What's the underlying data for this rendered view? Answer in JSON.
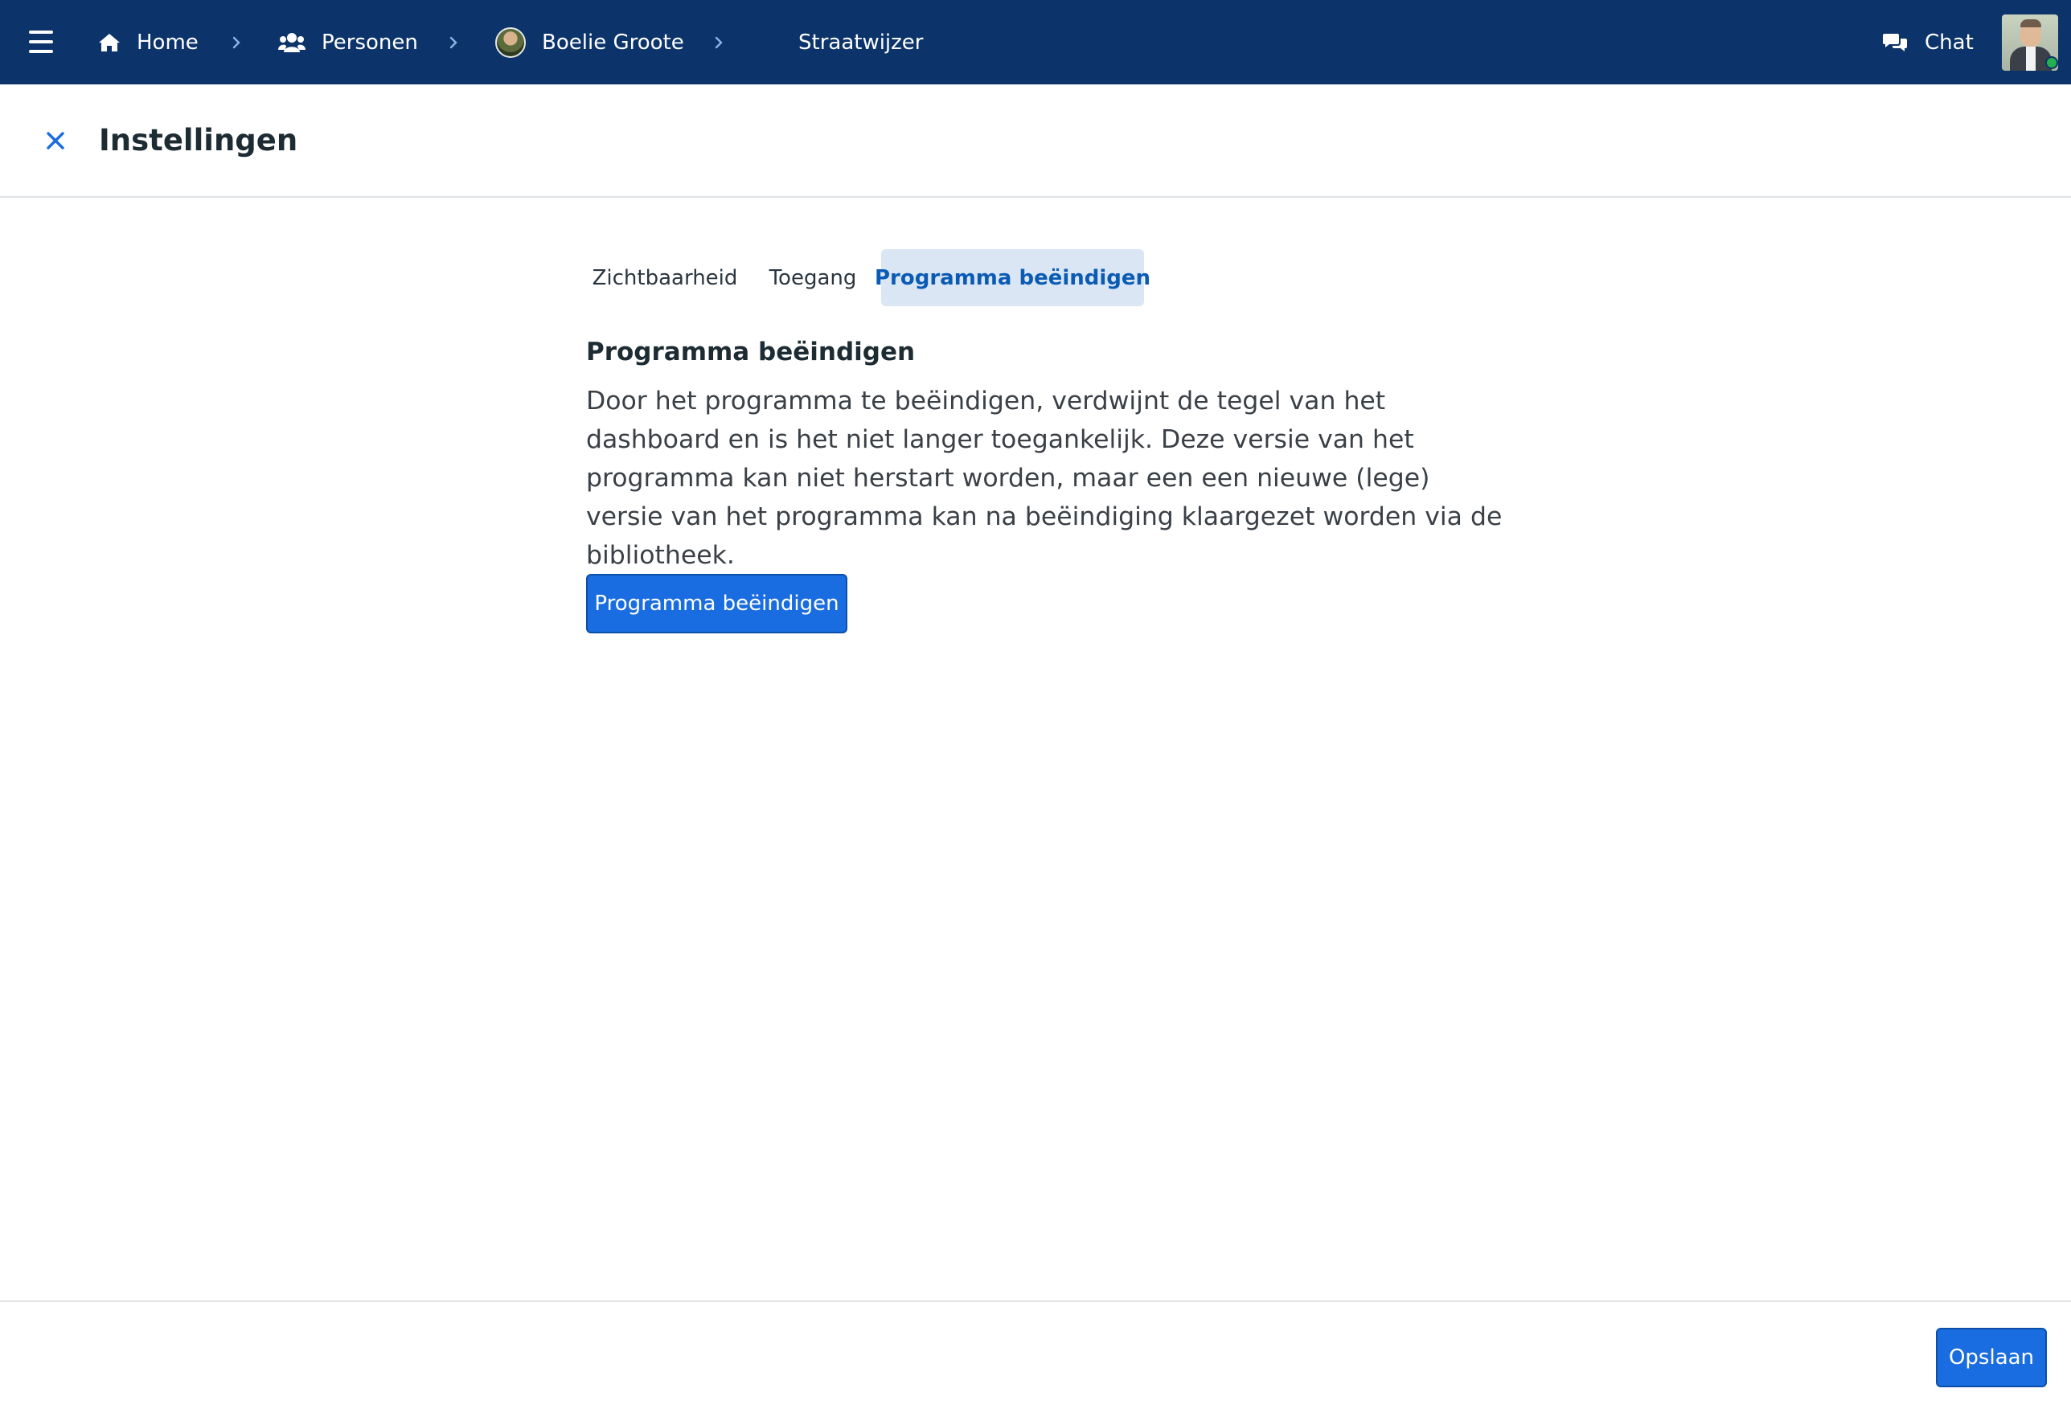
{
  "topbar": {
    "menu_icon": "hamburger-icon",
    "breadcrumbs": [
      {
        "label": "Home",
        "icon": "home-icon"
      },
      {
        "label": "Personen",
        "icon": "users-icon"
      },
      {
        "label": "Boelie Groote",
        "icon": "avatar"
      },
      {
        "label": "Straatwijzer",
        "icon": ""
      }
    ],
    "separator_icon": "chevron-right-icon",
    "chat_label": "Chat",
    "chat_icon": "comments-icon",
    "user_status": "online"
  },
  "header": {
    "close_icon": "close-icon",
    "title": "Instellingen"
  },
  "tabs": [
    {
      "label": "Zichtbaarheid",
      "active": false
    },
    {
      "label": "Toegang",
      "active": false
    },
    {
      "label": "Programma beëindigen",
      "active": true
    }
  ],
  "section": {
    "title": "Programma beëindigen",
    "text": "Door het programma te beëindigen, verdwijnt de tegel van het dashboard en is het niet langer toegankelijk. Deze versie van het programma kan niet herstart worden, maar een een nieuwe (lege) versie van het programma kan na beëindiging klaargezet worden via de bibliotheek.",
    "button_label": "Programma beëindigen"
  },
  "footer": {
    "save_label": "Opslaan"
  },
  "colors": {
    "topbar": "#0c346b",
    "primary": "#1a6de0",
    "active_tab_bg": "#dae6f4",
    "active_tab_text": "#0b5bb5",
    "status_online": "#23b14d"
  }
}
